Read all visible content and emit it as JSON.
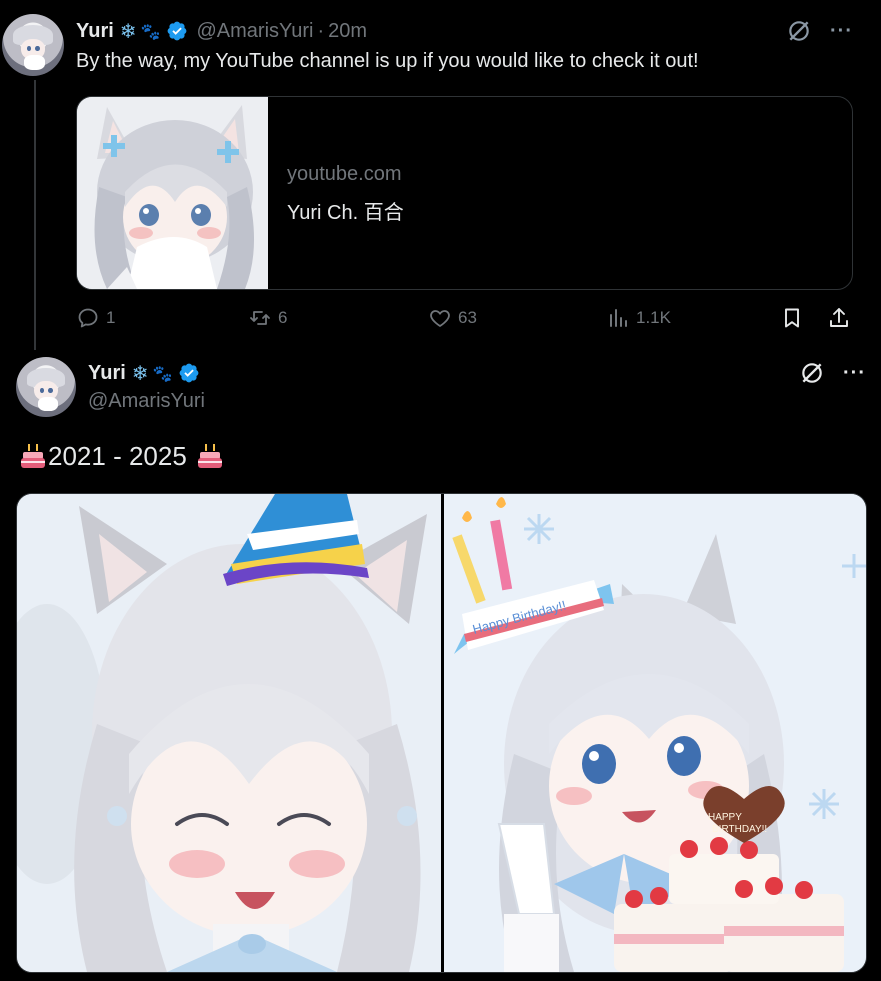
{
  "tweet1": {
    "display_name": "Yuri",
    "badges": [
      "snowflake-emoji",
      "paw-emoji"
    ],
    "verified": true,
    "handle": "@AmarisYuri",
    "separator": "·",
    "time": "20m",
    "text": "By the way, my YouTube channel is up if you would like to check it out!",
    "card": {
      "domain": "youtube.com",
      "title": "Yuri Ch. 百合"
    },
    "actions": {
      "replies": "1",
      "reposts": "6",
      "likes": "63",
      "views": "1.1K"
    }
  },
  "tweet2": {
    "display_name": "Yuri",
    "badges": [
      "snowflake-emoji",
      "paw-emoji"
    ],
    "verified": true,
    "handle": "@AmarisYuri",
    "text": "2021 - 2025",
    "leading_emoji": "birthday-cake-emoji",
    "trailing_emoji": "birthday-cake-emoji",
    "media": {
      "count": 2,
      "right_image_lettering": [
        "Happy Birthday!!",
        "HAPPY BIRTHDAY!!"
      ]
    }
  },
  "colors": {
    "background": "#000000",
    "text_primary": "#e7e9ea",
    "text_secondary": "#71767b",
    "verified_blue": "#1d9bf0",
    "border": "#2f3336"
  },
  "symbols": {
    "snowflake": "❄",
    "paw": "🐾",
    "more": "···"
  }
}
